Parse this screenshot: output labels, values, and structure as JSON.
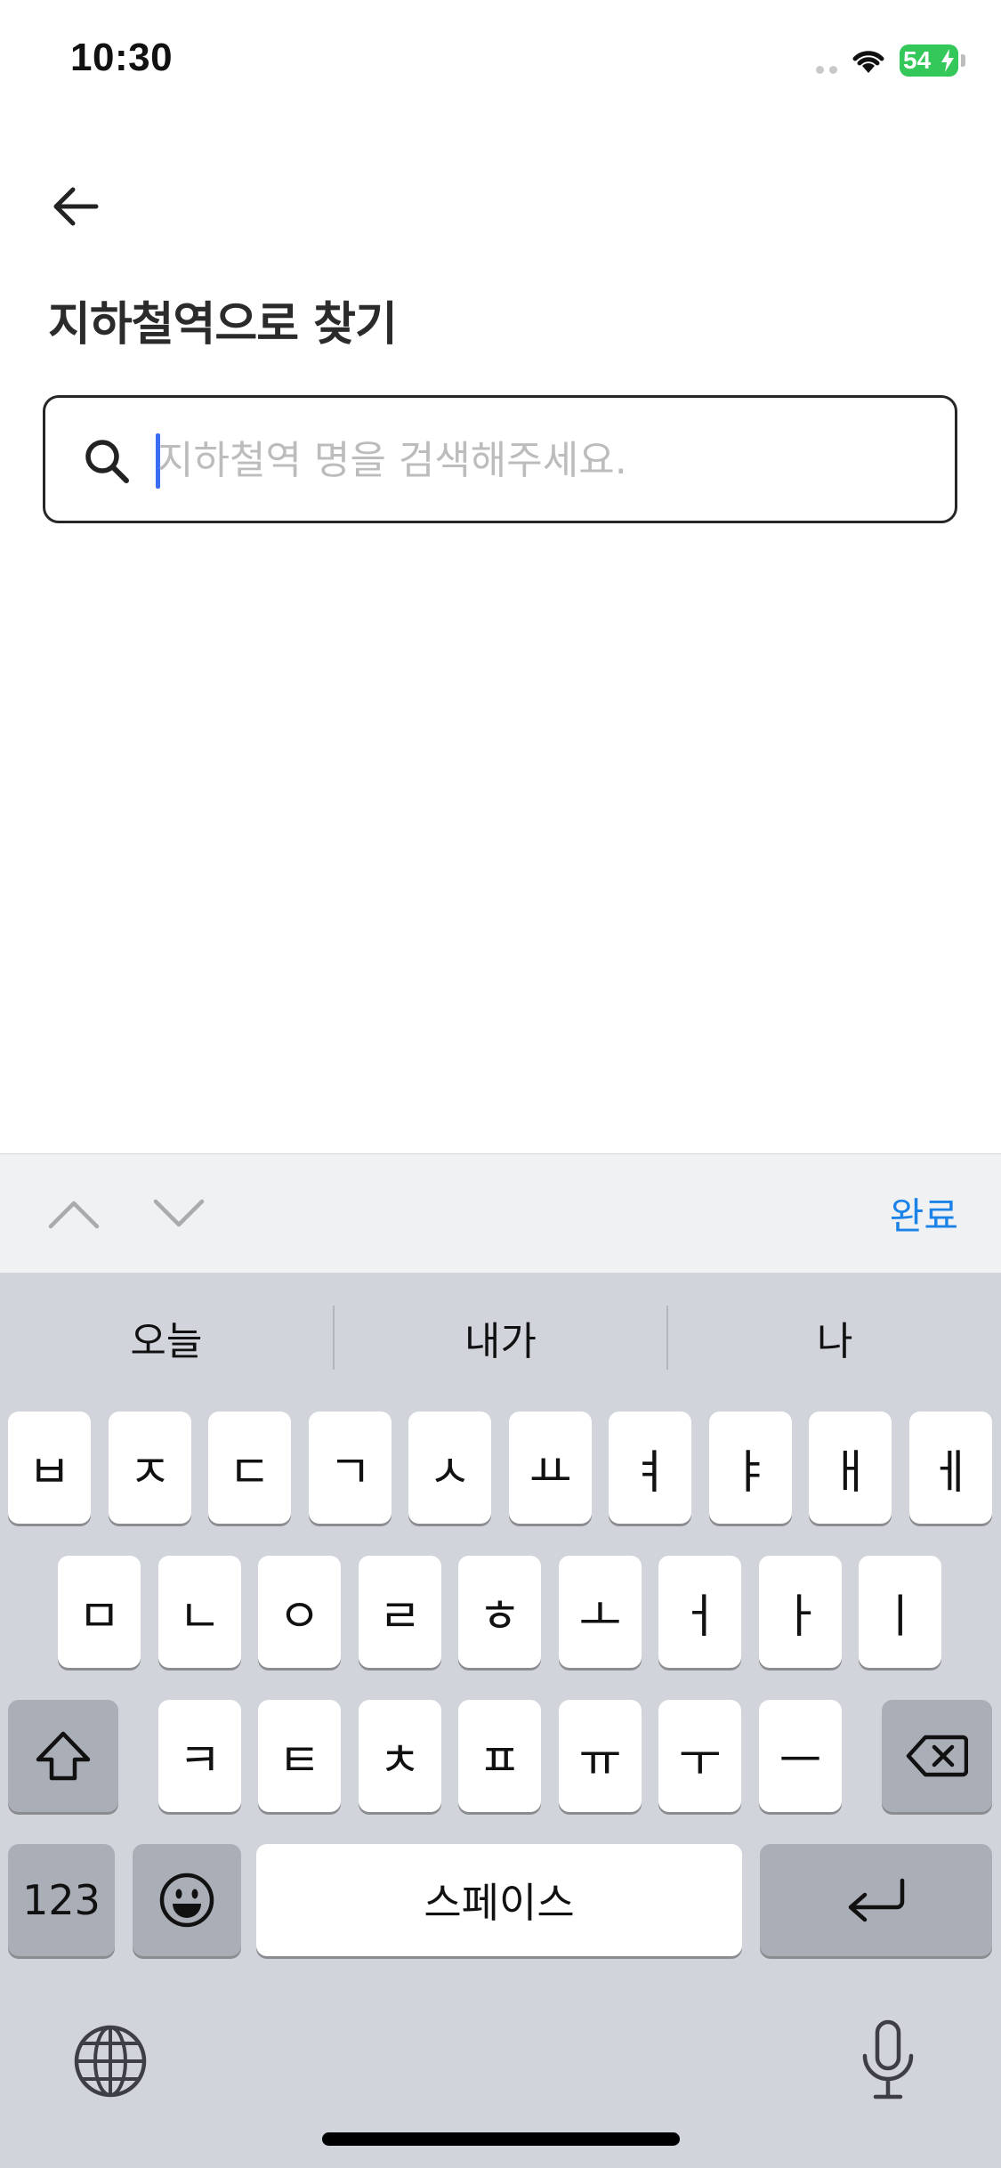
{
  "status_bar": {
    "time": "10:30",
    "battery": "54"
  },
  "header": {
    "title": "지하철역으로 찾기"
  },
  "search": {
    "value": "",
    "placeholder": "지하철역 명을 검색해주세요."
  },
  "accessory_bar": {
    "done_label": "완료"
  },
  "keyboard": {
    "suggestions": [
      "오늘",
      "내가",
      "나"
    ],
    "row1": [
      "ㅂ",
      "ㅈ",
      "ㄷ",
      "ㄱ",
      "ㅅ",
      "ㅛ",
      "ㅕ",
      "ㅑ",
      "ㅐ",
      "ㅔ"
    ],
    "row2": [
      "ㅁ",
      "ㄴ",
      "ㅇ",
      "ㄹ",
      "ㅎ",
      "ㅗ",
      "ㅓ",
      "ㅏ",
      "ㅣ"
    ],
    "row3": [
      "ㅋ",
      "ㅌ",
      "ㅊ",
      "ㅍ",
      "ㅠ",
      "ㅜ",
      "ㅡ"
    ],
    "numbers_label": "123",
    "space_label": "스페이스"
  },
  "icons": [
    "back-arrow-icon",
    "search-icon",
    "chevron-up-icon",
    "chevron-down-icon",
    "shift-icon",
    "delete-icon",
    "emoji-icon",
    "return-icon",
    "globe-icon",
    "microphone-icon",
    "wifi-icon"
  ]
}
